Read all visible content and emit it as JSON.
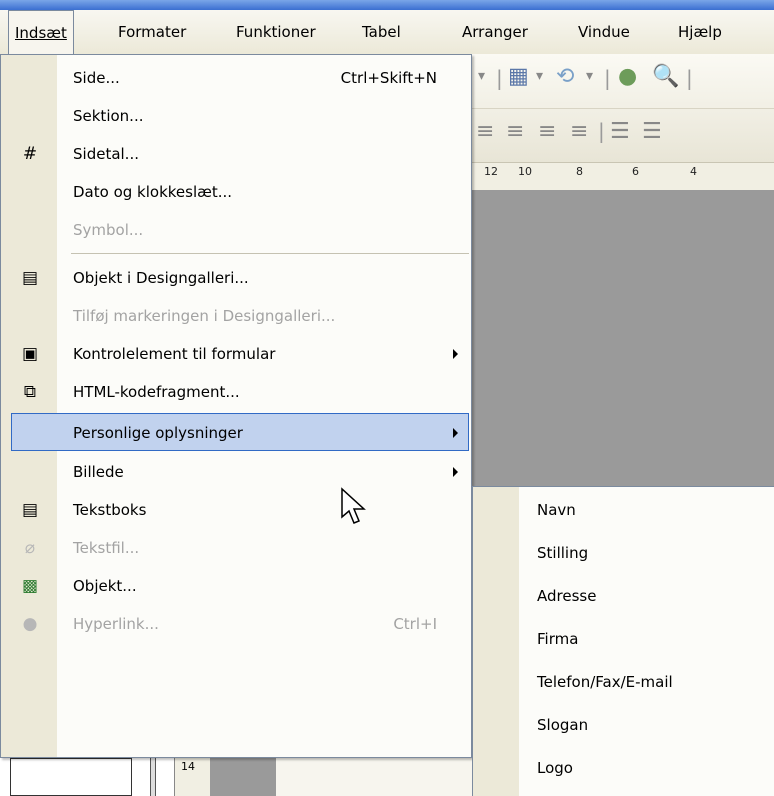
{
  "menubar": {
    "items": [
      {
        "label": "Indsæt"
      },
      {
        "label": "Formater"
      },
      {
        "label": "Funktioner"
      },
      {
        "label": "Tabel"
      },
      {
        "label": "Arranger"
      },
      {
        "label": "Vindue"
      },
      {
        "label": "Hjælp"
      }
    ]
  },
  "ruler": {
    "ticks": [
      "12",
      "10",
      "8",
      "6",
      "4"
    ]
  },
  "left_ruler": {
    "tick": "14"
  },
  "menu": {
    "items": [
      {
        "label": "Side...",
        "shortcut": "Ctrl+Skift+N",
        "enabled": true
      },
      {
        "label": "Sektion...",
        "enabled": true
      },
      {
        "label": "Sidetal...",
        "enabled": true,
        "icon": "page-number-icon"
      },
      {
        "label": "Dato og klokkeslæt...",
        "enabled": true
      },
      {
        "label": "Symbol...",
        "enabled": false
      },
      {
        "label": "Objekt i Designgalleri...",
        "enabled": true,
        "icon": "design-gallery-icon"
      },
      {
        "label": "Tilføj markeringen i Designgalleri...",
        "enabled": false
      },
      {
        "label": "Kontrolelement til formular",
        "enabled": true,
        "submenu": true,
        "icon": "form-control-icon"
      },
      {
        "label": "HTML-kodefragment...",
        "enabled": true,
        "icon": "html-fragment-icon"
      },
      {
        "label": "Personlige oplysninger",
        "enabled": true,
        "submenu": true,
        "highlighted": true
      },
      {
        "label": "Billede",
        "enabled": true,
        "submenu": true
      },
      {
        "label": "Tekstboks",
        "enabled": true,
        "icon": "text-box-icon"
      },
      {
        "label": "Tekstfil...",
        "enabled": false,
        "icon": "paperclip-icon"
      },
      {
        "label": "Objekt...",
        "enabled": true,
        "icon": "object-icon"
      },
      {
        "label": "Hyperlink...",
        "shortcut": "Ctrl+I",
        "enabled": false,
        "icon": "hyperlink-icon"
      }
    ]
  },
  "submenu": {
    "items": [
      {
        "label": "Navn"
      },
      {
        "label": "Stilling"
      },
      {
        "label": "Adresse"
      },
      {
        "label": "Firma"
      },
      {
        "label": "Telefon/Fax/E-mail"
      },
      {
        "label": "Slogan"
      },
      {
        "label": "Logo"
      }
    ]
  },
  "colors": {
    "highlight_bg": "#c1d2ee",
    "highlight_border": "#316ac5",
    "gutter": "#ece9d8",
    "disabled_text": "#a3a3a3"
  }
}
